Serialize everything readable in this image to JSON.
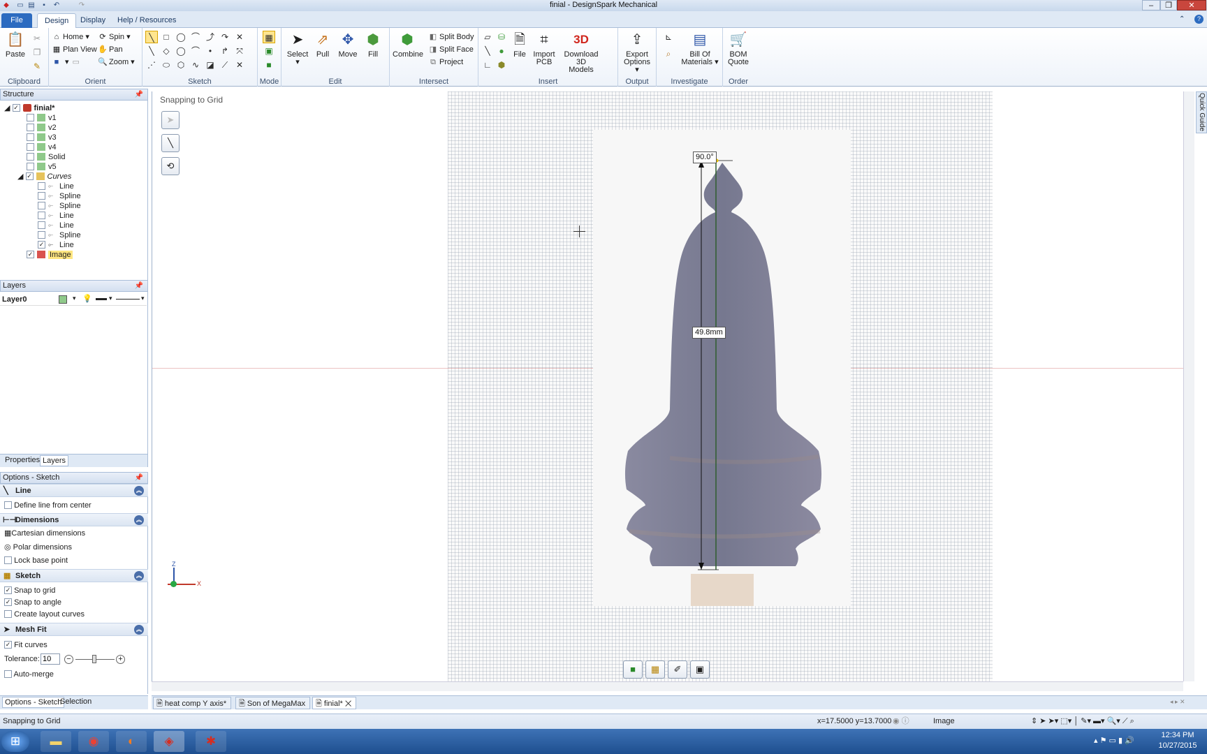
{
  "window": {
    "title": "finial - DesignSpark Mechanical"
  },
  "ribbon_tabs": [
    {
      "label": "File"
    },
    {
      "label": "Design"
    },
    {
      "label": "Display"
    },
    {
      "label": "Help / Resources"
    }
  ],
  "ribbon": {
    "clipboard": {
      "label": "Clipboard",
      "paste": "Paste"
    },
    "orient": {
      "label": "Orient",
      "home": "Home",
      "spin": "Spin",
      "plan_view": "Plan View",
      "pan": "Pan",
      "zoom": "Zoom"
    },
    "sketch": {
      "label": "Sketch"
    },
    "mode": {
      "label": "Mode"
    },
    "edit": {
      "label": "Edit",
      "select": "Select",
      "pull": "Pull",
      "move": "Move",
      "fill": "Fill"
    },
    "intersect": {
      "label": "Intersect",
      "combine": "Combine",
      "split_body": "Split Body",
      "split_face": "Split Face",
      "project": "Project"
    },
    "insert": {
      "label": "Insert",
      "file": "File",
      "import_pcb_1": "Import",
      "import_pcb_2": "PCB",
      "download_1": "Download 3D",
      "download_2": "Models"
    },
    "output": {
      "label": "Output",
      "export_1": "Export",
      "export_2": "Options"
    },
    "investigate": {
      "label": "Investigate",
      "bom_1": "Bill Of",
      "bom_2": "Materials"
    },
    "order": {
      "label": "Order",
      "bom_quote_1": "BOM",
      "bom_quote_2": "Quote"
    },
    "download_badge": "3D"
  },
  "structure": {
    "title": "Structure",
    "root": "finial*",
    "items": [
      {
        "label": "v1"
      },
      {
        "label": "v2"
      },
      {
        "label": "v3"
      },
      {
        "label": "v4"
      },
      {
        "label": "Solid"
      },
      {
        "label": "v5"
      }
    ],
    "curves_folder": "Curves",
    "curves": [
      {
        "label": "Line"
      },
      {
        "label": "Spline"
      },
      {
        "label": "Spline"
      },
      {
        "label": "Line"
      },
      {
        "label": "Line"
      },
      {
        "label": "Spline"
      },
      {
        "label": "Line"
      }
    ],
    "image": "Image"
  },
  "layers": {
    "title": "Layers",
    "layer_name": "Layer0"
  },
  "panel_tabs": {
    "properties": "Properties",
    "layers": "Layers"
  },
  "options": {
    "title": "Options - Sketch",
    "line_section": "Line",
    "define_line_from_center": "Define line from center",
    "dimensions_section": "Dimensions",
    "cartesian": "Cartesian dimensions",
    "polar": "Polar dimensions",
    "lock_base_point": "Lock base point",
    "sketch_section": "Sketch",
    "snap_to_grid": "Snap to grid",
    "snap_to_angle": "Snap to angle",
    "create_layout_curves": "Create layout curves",
    "mesh_fit_section": "Mesh Fit",
    "fit_curves": "Fit curves",
    "tolerance_label": "Tolerance:",
    "tolerance_value": "10",
    "auto_merge": "Auto-merge"
  },
  "bottom_left_tabs": {
    "options": "Options - Sketch",
    "selection": "Selection"
  },
  "canvas": {
    "snapping_label": "Snapping to Grid",
    "dim_length": "49.8mm",
    "dim_angle": "90.0°",
    "axis_z": "Z",
    "axis_x": "X"
  },
  "doc_tabs": [
    {
      "label": "heat comp Y axis*"
    },
    {
      "label": "Son of MegaMax"
    },
    {
      "label": "finial*"
    }
  ],
  "status": {
    "left": "Snapping to Grid",
    "coords": "x=17.5000  y=13.7000",
    "selection_filter": "Image"
  },
  "quick_guide": "Quick Guide",
  "taskbar": {
    "time": "12:34 PM",
    "date": "10/27/2015"
  },
  "colors": {
    "accent": "#2c6bc0",
    "finial": "#7d7f96",
    "dimension_line": "#2f5d2f"
  }
}
